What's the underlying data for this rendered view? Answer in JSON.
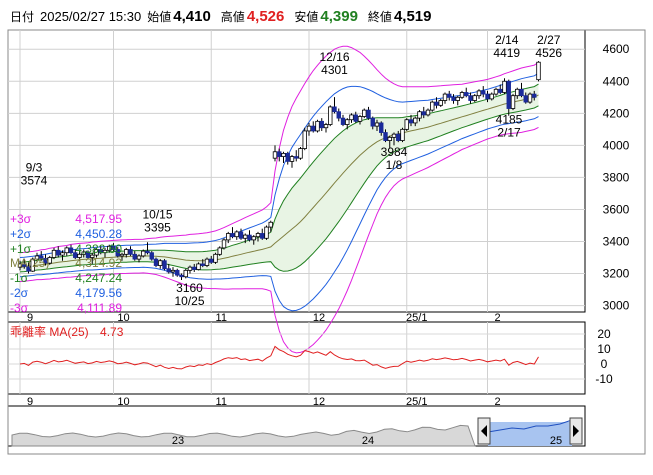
{
  "header": {
    "date_label": "日付",
    "date": "2025/02/27 15:30",
    "open_label": "始値",
    "open": "4,410",
    "high_label": "高値",
    "high": "4,526",
    "low_label": "安値",
    "low": "4,399",
    "close_label": "終値",
    "close": "4,519"
  },
  "legend": [
    {
      "key": "+3σ",
      "value": "4,517.95",
      "color": "#e020e0"
    },
    {
      "key": "+2σ",
      "value": "4,450.28",
      "color": "#2060e0"
    },
    {
      "key": "+1σ",
      "value": "4,382.60",
      "color": "#208020"
    },
    {
      "key": "MA(25)",
      "value": "4,314.92",
      "color": "#808040"
    },
    {
      "key": "-1σ",
      "value": "4,247.24",
      "color": "#208020"
    },
    {
      "key": "-2σ",
      "value": "4,179.56",
      "color": "#2060e0"
    },
    {
      "key": "-3σ",
      "value": "4,111.89",
      "color": "#e020e0"
    }
  ],
  "oscillator": {
    "label": "乖離率 MA(25)",
    "value": "4.73",
    "color": "#e02020"
  },
  "navigator": {
    "labels": [
      "23",
      "24",
      "25"
    ]
  },
  "colors": {
    "up": "#ffffff",
    "down": "#1a2a9a",
    "ma": "#808040",
    "s1": "#208020",
    "s2": "#2060e0",
    "s3": "#e020e0",
    "band_fill": "#e8f4e4"
  },
  "chart_data": [
    {
      "type": "candlestick",
      "title": "",
      "x_tick_labels": [
        "9",
        "10",
        "11",
        "12",
        "25/1",
        "2"
      ],
      "y_tick_labels": [
        "4600",
        "4400",
        "4200",
        "4000",
        "3800",
        "3600",
        "3400",
        "3200",
        "3000"
      ],
      "ylim": [
        2960,
        4720
      ],
      "grid": true,
      "annotations": [
        {
          "text": "9/3\n3574",
          "x": 0,
          "y": 3574
        },
        {
          "text": "10/15\n3395",
          "x": 30,
          "y": 3395
        },
        {
          "text": "3160\n10/25",
          "x": 38,
          "y": 3160
        },
        {
          "text": "12/16\n4301",
          "x": 74,
          "y": 4301
        },
        {
          "text": "3984\n1/8",
          "x": 88,
          "y": 3984
        },
        {
          "text": "2/14\n4419",
          "x": 115,
          "y": 4419
        },
        {
          "text": "4185\n2/17",
          "x": 116,
          "y": 4185
        },
        {
          "text": "2/27\n4526",
          "x": 123,
          "y": 4526
        }
      ],
      "ohlc": [
        [
          3240,
          3280,
          3220,
          3260
        ],
        [
          3255,
          3290,
          3230,
          3245
        ],
        [
          3245,
          3270,
          3200,
          3215
        ],
        [
          3215,
          3300,
          3210,
          3290
        ],
        [
          3290,
          3330,
          3270,
          3310
        ],
        [
          3310,
          3340,
          3280,
          3295
        ],
        [
          3295,
          3320,
          3250,
          3265
        ],
        [
          3265,
          3310,
          3255,
          3300
        ],
        [
          3300,
          3360,
          3290,
          3345
        ],
        [
          3345,
          3370,
          3300,
          3315
        ],
        [
          3315,
          3345,
          3280,
          3330
        ],
        [
          3330,
          3370,
          3310,
          3360
        ],
        [
          3360,
          3380,
          3320,
          3330
        ],
        [
          3330,
          3350,
          3290,
          3300
        ],
        [
          3300,
          3340,
          3280,
          3320
        ],
        [
          3320,
          3350,
          3300,
          3335
        ],
        [
          3335,
          3345,
          3290,
          3300
        ],
        [
          3300,
          3330,
          3260,
          3315
        ],
        [
          3315,
          3360,
          3300,
          3350
        ],
        [
          3350,
          3370,
          3320,
          3330
        ],
        [
          3330,
          3360,
          3300,
          3345
        ],
        [
          3345,
          3380,
          3330,
          3370
        ],
        [
          3370,
          3390,
          3340,
          3350
        ],
        [
          3350,
          3365,
          3300,
          3310
        ],
        [
          3310,
          3330,
          3280,
          3320
        ],
        [
          3320,
          3360,
          3300,
          3350
        ],
        [
          3350,
          3370,
          3310,
          3320
        ],
        [
          3320,
          3340,
          3280,
          3290
        ],
        [
          3290,
          3320,
          3270,
          3310
        ],
        [
          3310,
          3350,
          3300,
          3340
        ],
        [
          3340,
          3395,
          3320,
          3330
        ],
        [
          3330,
          3340,
          3280,
          3290
        ],
        [
          3290,
          3300,
          3240,
          3250
        ],
        [
          3250,
          3290,
          3230,
          3280
        ],
        [
          3280,
          3290,
          3220,
          3230
        ],
        [
          3230,
          3260,
          3200,
          3210
        ],
        [
          3210,
          3240,
          3180,
          3220
        ],
        [
          3220,
          3230,
          3180,
          3190
        ],
        [
          3190,
          3200,
          3160,
          3180
        ],
        [
          3180,
          3230,
          3170,
          3220
        ],
        [
          3220,
          3250,
          3200,
          3240
        ],
        [
          3240,
          3260,
          3210,
          3225
        ],
        [
          3225,
          3270,
          3220,
          3260
        ],
        [
          3260,
          3290,
          3240,
          3250
        ],
        [
          3250,
          3300,
          3240,
          3290
        ],
        [
          3290,
          3310,
          3260,
          3270
        ],
        [
          3270,
          3330,
          3260,
          3320
        ],
        [
          3320,
          3370,
          3310,
          3360
        ],
        [
          3360,
          3420,
          3350,
          3410
        ],
        [
          3410,
          3460,
          3390,
          3450
        ],
        [
          3450,
          3490,
          3420,
          3430
        ],
        [
          3430,
          3470,
          3410,
          3460
        ],
        [
          3460,
          3480,
          3410,
          3420
        ],
        [
          3420,
          3450,
          3390,
          3440
        ],
        [
          3440,
          3470,
          3400,
          3410
        ],
        [
          3410,
          3440,
          3380,
          3430
        ],
        [
          3430,
          3460,
          3400,
          3450
        ],
        [
          3450,
          3480,
          3410,
          3420
        ],
        [
          3420,
          3500,
          3410,
          3490
        ],
        [
          3490,
          3530,
          3460,
          3520
        ],
        [
          3920,
          4000,
          3900,
          3960
        ],
        [
          3960,
          3980,
          3900,
          3930
        ],
        [
          3930,
          3960,
          3890,
          3950
        ],
        [
          3950,
          3960,
          3880,
          3900
        ],
        [
          3900,
          3940,
          3860,
          3930
        ],
        [
          3930,
          3970,
          3900,
          3920
        ],
        [
          3920,
          3990,
          3910,
          3980
        ],
        [
          3980,
          4110,
          3970,
          4090
        ],
        [
          4090,
          4140,
          4060,
          4120
        ],
        [
          4120,
          4150,
          4080,
          4090
        ],
        [
          4090,
          4160,
          4080,
          4150
        ],
        [
          4150,
          4170,
          4090,
          4110
        ],
        [
          4110,
          4140,
          4080,
          4130
        ],
        [
          4130,
          4250,
          4120,
          4240
        ],
        [
          4240,
          4301,
          4200,
          4210
        ],
        [
          4210,
          4230,
          4150,
          4170
        ],
        [
          4170,
          4190,
          4120,
          4130
        ],
        [
          4130,
          4170,
          4100,
          4160
        ],
        [
          4160,
          4200,
          4140,
          4190
        ],
        [
          4190,
          4210,
          4140,
          4150
        ],
        [
          4150,
          4190,
          4130,
          4180
        ],
        [
          4180,
          4230,
          4170,
          4220
        ],
        [
          4220,
          4240,
          4160,
          4170
        ],
        [
          4170,
          4180,
          4100,
          4120
        ],
        [
          4120,
          4160,
          4090,
          4140
        ],
        [
          4140,
          4150,
          4060,
          4080
        ],
        [
          4080,
          4100,
          4020,
          4030
        ],
        [
          4030,
          4060,
          3984,
          4050
        ],
        [
          4050,
          4080,
          4000,
          4070
        ],
        [
          4070,
          4090,
          4020,
          4030
        ],
        [
          4030,
          4110,
          4020,
          4100
        ],
        [
          4100,
          4170,
          4090,
          4160
        ],
        [
          4160,
          4190,
          4120,
          4140
        ],
        [
          4140,
          4180,
          4120,
          4170
        ],
        [
          4170,
          4220,
          4150,
          4210
        ],
        [
          4210,
          4240,
          4170,
          4190
        ],
        [
          4190,
          4230,
          4180,
          4220
        ],
        [
          4220,
          4280,
          4210,
          4270
        ],
        [
          4270,
          4300,
          4230,
          4250
        ],
        [
          4250,
          4290,
          4240,
          4280
        ],
        [
          4280,
          4330,
          4260,
          4320
        ],
        [
          4320,
          4340,
          4280,
          4300
        ],
        [
          4300,
          4320,
          4260,
          4280
        ],
        [
          4280,
          4310,
          4250,
          4300
        ],
        [
          4300,
          4340,
          4290,
          4330
        ],
        [
          4330,
          4360,
          4300,
          4310
        ],
        [
          4310,
          4330,
          4260,
          4280
        ],
        [
          4280,
          4320,
          4270,
          4310
        ],
        [
          4310,
          4350,
          4290,
          4340
        ],
        [
          4340,
          4370,
          4300,
          4320
        ],
        [
          4320,
          4340,
          4270,
          4290
        ],
        [
          4290,
          4330,
          4280,
          4320
        ],
        [
          4320,
          4360,
          4310,
          4350
        ],
        [
          4350,
          4380,
          4320,
          4330
        ],
        [
          4330,
          4419,
          4320,
          4400
        ],
        [
          4400,
          4410,
          4185,
          4230
        ],
        [
          4230,
          4320,
          4220,
          4310
        ],
        [
          4310,
          4360,
          4290,
          4350
        ],
        [
          4350,
          4390,
          4300,
          4310
        ],
        [
          4310,
          4330,
          4260,
          4270
        ],
        [
          4270,
          4330,
          4260,
          4320
        ],
        [
          4320,
          4340,
          4280,
          4300
        ],
        [
          4410,
          4526,
          4399,
          4519
        ]
      ],
      "ma25": [
        3240,
        3242,
        3245,
        3248,
        3252,
        3255,
        3258,
        3262,
        3266,
        3270,
        3273,
        3276,
        3280,
        3283,
        3286,
        3288,
        3290,
        3292,
        3294,
        3296,
        3298,
        3300,
        3302,
        3304,
        3305,
        3306,
        3307,
        3308,
        3308,
        3309,
        3310,
        3309,
        3308,
        3306,
        3304,
        3300,
        3296,
        3292,
        3288,
        3284,
        3282,
        3281,
        3280,
        3280,
        3281,
        3283,
        3286,
        3290,
        3295,
        3301,
        3308,
        3314,
        3320,
        3327,
        3333,
        3339,
        3345,
        3351,
        3358,
        3366,
        3390,
        3412,
        3434,
        3456,
        3478,
        3500,
        3524,
        3552,
        3582,
        3612,
        3642,
        3672,
        3702,
        3734,
        3766,
        3796,
        3826,
        3856,
        3884,
        3912,
        3938,
        3962,
        3984,
        4004,
        4022,
        4036,
        4048,
        4058,
        4066,
        4072,
        4078,
        4084,
        4090,
        4096,
        4102,
        4108,
        4114,
        4122,
        4130,
        4138,
        4146,
        4154,
        4162,
        4170,
        4178,
        4186,
        4194,
        4202,
        4210,
        4218,
        4226,
        4234,
        4242,
        4250,
        4258,
        4264,
        4270,
        4276,
        4282,
        4288,
        4294,
        4300,
        4314.92
      ],
      "sigma": [
        30,
        30,
        30,
        30,
        30,
        31,
        31,
        32,
        32,
        33,
        33,
        33,
        34,
        34,
        34,
        34,
        34,
        35,
        35,
        35,
        35,
        35,
        35,
        35,
        35,
        35,
        35,
        35,
        35,
        35,
        36,
        37,
        38,
        40,
        42,
        44,
        46,
        48,
        50,
        52,
        54,
        55,
        56,
        57,
        58,
        59,
        60,
        62,
        64,
        66,
        68,
        70,
        72,
        74,
        76,
        78,
        80,
        82,
        86,
        92,
        150,
        190,
        220,
        240,
        255,
        265,
        272,
        278,
        282,
        285,
        286,
        286,
        285,
        282,
        278,
        272,
        264,
        254,
        242,
        228,
        214,
        198,
        182,
        166,
        150,
        136,
        124,
        114,
        106,
        100,
        96,
        94,
        92,
        90,
        88,
        86,
        84,
        82,
        80,
        78,
        76,
        74,
        72,
        70,
        68,
        67,
        66,
        65,
        64,
        63,
        62,
        62,
        62,
        62,
        63,
        64,
        65,
        66,
        67,
        67,
        67,
        67,
        67.7
      ]
    },
    {
      "type": "line",
      "title": "",
      "name": "乖離率 MA(25)",
      "y_tick_labels": [
        "20",
        "10",
        "0",
        "-10"
      ],
      "ylim": [
        -20,
        28
      ],
      "values": [
        0.0,
        0.4,
        -0.9,
        1.3,
        1.8,
        1.2,
        0.2,
        1.2,
        2.4,
        1.4,
        1.7,
        2.5,
        1.5,
        0.5,
        1.0,
        1.4,
        0.3,
        0.7,
        1.7,
        1.0,
        1.4,
        2.1,
        1.4,
        0.2,
        0.5,
        1.3,
        0.4,
        -0.5,
        0.1,
        0.9,
        0.6,
        -0.6,
        -1.8,
        -0.8,
        -2.2,
        -3.0,
        -2.3,
        -3.1,
        -3.3,
        -2.0,
        -1.3,
        -1.7,
        -0.6,
        -0.9,
        0.3,
        -0.4,
        1.0,
        2.1,
        3.4,
        4.2,
        3.7,
        4.3,
        3.0,
        3.4,
        2.3,
        2.7,
        3.2,
        1.9,
        3.9,
        5.5,
        11.7,
        9.5,
        8.3,
        6.5,
        5.5,
        4.8,
        5.8,
        8.9,
        8.3,
        7.2,
        8.1,
        6.9,
        5.8,
        8.2,
        6.0,
        4.5,
        3.5,
        3.0,
        3.4,
        2.3,
        2.2,
        2.6,
        0.9,
        -0.8,
        -0.4,
        -1.9,
        -2.9,
        -2.1,
        -1.6,
        -1.5,
        0.3,
        1.9,
        1.2,
        1.8,
        2.6,
        1.9,
        2.5,
        3.5,
        2.9,
        3.4,
        4.1,
        3.5,
        2.8,
        3.1,
        3.7,
        3.0,
        2.0,
        2.6,
        3.1,
        2.4,
        1.5,
        2.0,
        2.6,
        2.0,
        3.2,
        -0.8,
        1.0,
        1.7,
        0.7,
        -0.4,
        0.6,
        0.0,
        4.73
      ]
    }
  ]
}
